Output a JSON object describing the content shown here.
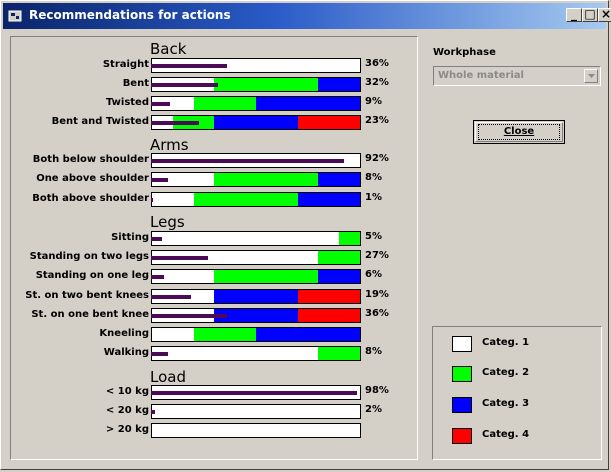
{
  "window": {
    "title": "Recommendations for actions",
    "buttons": {
      "minimize": "_",
      "maximize": "□",
      "close": "×"
    }
  },
  "colors": {
    "categ1": "#ffffff",
    "categ2": "#00ff00",
    "categ3": "#0000ff",
    "categ4": "#ff0000",
    "frequency_bar": "#4b0b57"
  },
  "groups": [
    {
      "title": "Back",
      "rows": [
        {
          "label": "Straight",
          "pct": "36%",
          "frequency": 36,
          "segments": [
            1,
            1,
            1,
            1,
            1,
            1,
            1,
            1,
            1,
            1
          ]
        },
        {
          "label": "Bent",
          "pct": "32%",
          "frequency": 32,
          "segments": [
            1,
            1,
            1,
            2,
            2,
            2,
            2,
            2,
            3,
            3
          ]
        },
        {
          "label": "Twisted",
          "pct": "9%",
          "frequency": 9,
          "segments": [
            1,
            1,
            2,
            2,
            2,
            3,
            3,
            3,
            3,
            3
          ]
        },
        {
          "label": "Bent and Twisted",
          "pct": "23%",
          "frequency": 23,
          "segments": [
            1,
            2,
            2,
            3,
            3,
            3,
            3,
            4,
            4,
            4
          ]
        }
      ]
    },
    {
      "title": "Arms",
      "rows": [
        {
          "label": "Both below shoulder",
          "pct": "92%",
          "frequency": 92,
          "segments": [
            1,
            1,
            1,
            1,
            1,
            1,
            1,
            1,
            1,
            1
          ]
        },
        {
          "label": "One above shoulder",
          "pct": "8%",
          "frequency": 8,
          "segments": [
            1,
            1,
            1,
            2,
            2,
            2,
            2,
            2,
            3,
            3
          ]
        },
        {
          "label": "Both above shoulder",
          "pct": "1%",
          "frequency": 1,
          "segments": [
            1,
            1,
            2,
            2,
            2,
            2,
            2,
            3,
            3,
            3
          ]
        }
      ]
    },
    {
      "title": "Legs",
      "rows": [
        {
          "label": "Sitting",
          "pct": "5%",
          "frequency": 5,
          "segments": [
            1,
            1,
            1,
            1,
            1,
            1,
            1,
            1,
            1,
            2
          ]
        },
        {
          "label": "Standing on two legs",
          "pct": "27%",
          "frequency": 27,
          "segments": [
            1,
            1,
            1,
            1,
            1,
            1,
            1,
            1,
            2,
            2
          ]
        },
        {
          "label": "Standing on one leg",
          "pct": "6%",
          "frequency": 6,
          "segments": [
            1,
            1,
            1,
            2,
            2,
            2,
            2,
            2,
            3,
            3
          ]
        },
        {
          "label": "St. on two bent knees",
          "pct": "19%",
          "frequency": 19,
          "segments": [
            1,
            1,
            1,
            3,
            3,
            3,
            3,
            4,
            4,
            4
          ]
        },
        {
          "label": "St. on one bent knee",
          "pct": "36%",
          "frequency": 36,
          "segments": [
            1,
            1,
            1,
            3,
            3,
            3,
            3,
            4,
            4,
            4
          ]
        },
        {
          "label": "Kneeling",
          "pct": "",
          "frequency": 0,
          "segments": [
            1,
            1,
            2,
            2,
            2,
            3,
            3,
            3,
            3,
            3
          ]
        },
        {
          "label": "Walking",
          "pct": "8%",
          "frequency": 8,
          "segments": [
            1,
            1,
            1,
            1,
            1,
            1,
            1,
            1,
            2,
            2
          ]
        }
      ]
    },
    {
      "title": "Load",
      "rows": [
        {
          "label": "< 10 kg",
          "pct": "98%",
          "frequency": 98,
          "segments": [
            1,
            1,
            1,
            1,
            1,
            1,
            1,
            1,
            1,
            1
          ]
        },
        {
          "label": "< 20 kg",
          "pct": "2%",
          "frequency": 2,
          "segments": [
            1,
            1,
            1,
            1,
            1,
            1,
            1,
            1,
            1,
            1
          ]
        },
        {
          "label": "> 20 kg",
          "pct": "",
          "frequency": 0,
          "segments": [
            1,
            1,
            1,
            1,
            1,
            1,
            1,
            1,
            1,
            1
          ]
        }
      ]
    }
  ],
  "workphase": {
    "label": "Workphase",
    "selected": "Whole material"
  },
  "close_button": {
    "label": "Close"
  },
  "legend": [
    {
      "label": "Categ. 1",
      "color": "#ffffff"
    },
    {
      "label": "Categ. 2",
      "color": "#00ff00"
    },
    {
      "label": "Categ. 3",
      "color": "#0000ff"
    },
    {
      "label": "Categ. 4",
      "color": "#ff0000"
    }
  ]
}
